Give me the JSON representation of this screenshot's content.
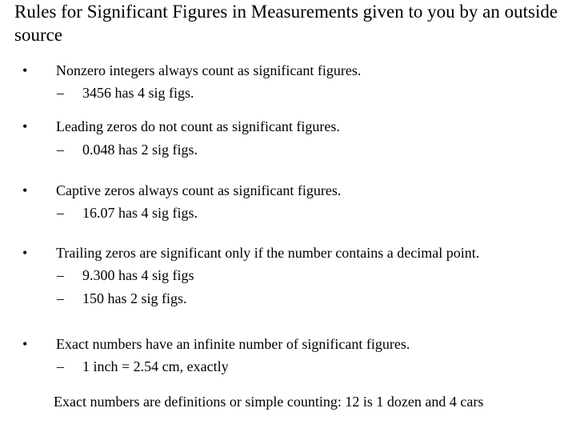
{
  "title": "Rules for Significant Figures in Measurements given to you by an outside source",
  "rules": [
    {
      "text": "Nonzero integers always count as significant figures.",
      "examples": [
        "3456 has 4 sig figs."
      ]
    },
    {
      "text": "Leading zeros do not count as significant figures.",
      "examples": [
        "0.048 has 2 sig figs."
      ]
    },
    {
      "text": "Captive zeros always count as significant figures.",
      "examples": [
        "16.07 has 4 sig figs."
      ]
    },
    {
      "text": "Trailing zeros are significant only if the number contains a decimal point.",
      "examples": [
        "9.300 has 4 sig figs",
        "150 has 2 sig figs."
      ]
    },
    {
      "text": "Exact numbers have an infinite number of significant figures.",
      "examples": [
        "1 inch = 2.54 cm, exactly"
      ]
    }
  ],
  "bullet_glyph": "•",
  "dash_glyph": "–",
  "note": "Exact numbers are definitions or simple counting:  12 is 1 dozen and 4 cars"
}
